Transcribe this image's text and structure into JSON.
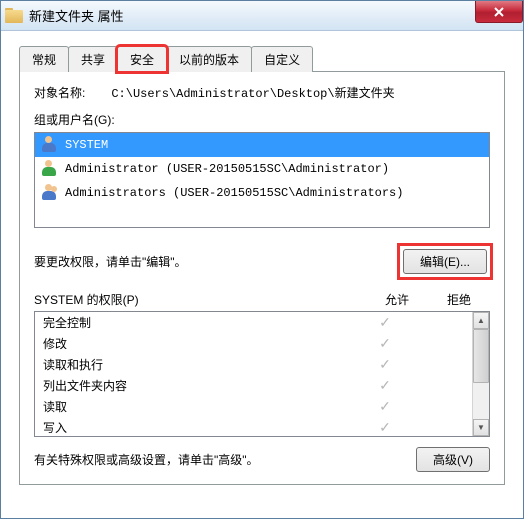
{
  "window": {
    "title": "新建文件夹 属性"
  },
  "tabs": {
    "general": "常规",
    "sharing": "共享",
    "security": "安全",
    "previous": "以前的版本",
    "custom": "自定义"
  },
  "object": {
    "label": "对象名称:",
    "path": "C:\\Users\\Administrator\\Desktop\\新建文件夹"
  },
  "groups": {
    "label": "组或用户名(G):",
    "items": [
      {
        "name": "SYSTEM",
        "selected": true,
        "iconType": "single"
      },
      {
        "name": "Administrator (USER-20150515SC\\Administrator)",
        "selected": false,
        "iconType": "green"
      },
      {
        "name": "Administrators (USER-20150515SC\\Administrators)",
        "selected": false,
        "iconType": "multi"
      }
    ]
  },
  "edit": {
    "text": "要更改权限，请单击\"编辑\"。",
    "button": "编辑(E)..."
  },
  "permissions": {
    "header_subject": "SYSTEM 的权限(P)",
    "col_allow": "允许",
    "col_deny": "拒绝",
    "rows": [
      {
        "name": "完全控制",
        "allow": true,
        "deny": false
      },
      {
        "name": "修改",
        "allow": true,
        "deny": false
      },
      {
        "name": "读取和执行",
        "allow": true,
        "deny": false
      },
      {
        "name": "列出文件夹内容",
        "allow": true,
        "deny": false
      },
      {
        "name": "读取",
        "allow": true,
        "deny": false
      },
      {
        "name": "写入",
        "allow": true,
        "deny": false
      }
    ]
  },
  "advanced": {
    "text": "有关特殊权限或高级设置，请单击\"高级\"。",
    "button": "高级(V)"
  },
  "glyphs": {
    "check": "✓",
    "arrow_up": "▲",
    "arrow_down": "▼"
  }
}
